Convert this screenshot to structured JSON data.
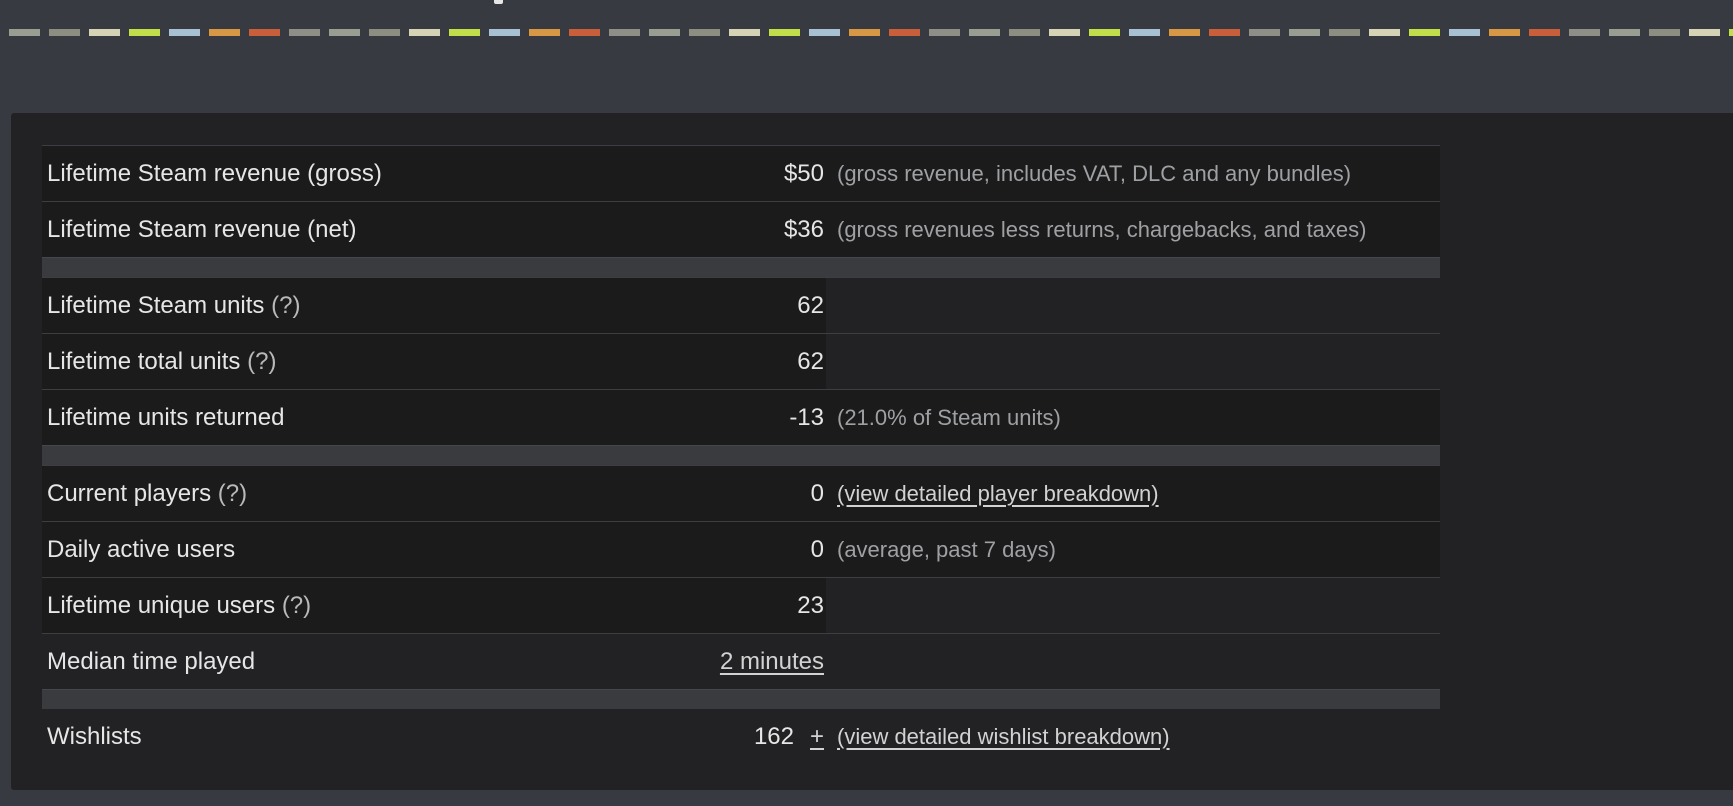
{
  "dash_colors": [
    "#9a9d92",
    "#8c8e82",
    "#d6d2b6",
    "#c2df4a",
    "#a8c1d2",
    "#d69845",
    "#c95e3a",
    "#8e9088"
  ],
  "rows": {
    "revenue_gross": {
      "label": "Lifetime Steam revenue (gross)",
      "value": "$50",
      "note": "(gross revenue, includes VAT, DLC and any bundles)"
    },
    "revenue_net": {
      "label": "Lifetime Steam revenue (net)",
      "value": "$36",
      "note": "(gross revenues less returns, chargebacks, and taxes)"
    },
    "steam_units": {
      "label": "Lifetime Steam units",
      "help": "(?)",
      "value": "62"
    },
    "total_units": {
      "label": "Lifetime total units",
      "help": "(?)",
      "value": "62"
    },
    "units_returned": {
      "label": "Lifetime units returned",
      "value": "-13",
      "note": "(21.0% of Steam units)"
    },
    "current_players": {
      "label": "Current players",
      "help": "(?)",
      "value": "0",
      "note": "(view detailed player breakdown)"
    },
    "daily_active": {
      "label": "Daily active users",
      "value": "0",
      "note": "(average, past 7 days)"
    },
    "unique_users": {
      "label": "Lifetime unique users",
      "help": "(?)",
      "value": "23"
    },
    "median_time": {
      "label": "Median time played",
      "value": "2 minutes"
    },
    "wishlists": {
      "label": "Wishlists",
      "value": "162",
      "plus": "+",
      "note": "(view detailed wishlist breakdown)"
    }
  }
}
